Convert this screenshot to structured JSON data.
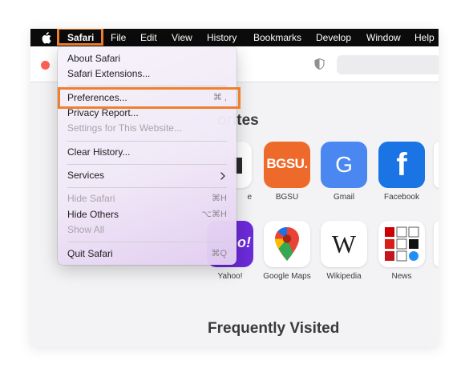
{
  "menubar": {
    "items": [
      {
        "label": "Safari",
        "key": "safari"
      },
      {
        "label": "File",
        "key": "file"
      },
      {
        "label": "Edit",
        "key": "edit"
      },
      {
        "label": "View",
        "key": "view"
      },
      {
        "label": "History",
        "key": "history"
      },
      {
        "label": "Bookmarks",
        "key": "bookmarks"
      },
      {
        "label": "Develop",
        "key": "develop"
      },
      {
        "label": "Window",
        "key": "window"
      },
      {
        "label": "Help",
        "key": "help"
      }
    ]
  },
  "safari_menu": {
    "items": [
      {
        "label": "About Safari",
        "shortcut": "",
        "enabled": true
      },
      {
        "label": "Safari Extensions...",
        "shortcut": "",
        "enabled": true
      },
      {
        "label": "Preferences...",
        "shortcut": "⌘ ,",
        "enabled": true,
        "highlighted": true
      },
      {
        "label": "Privacy Report...",
        "shortcut": "",
        "enabled": true
      },
      {
        "label": "Settings for This Website...",
        "shortcut": "",
        "enabled": false
      },
      {
        "label": "Clear History...",
        "shortcut": "",
        "enabled": true
      },
      {
        "label": "Services",
        "shortcut": "",
        "enabled": true,
        "submenu": true
      },
      {
        "label": "Hide Safari",
        "shortcut": "⌘H",
        "enabled": false
      },
      {
        "label": "Hide Others",
        "shortcut": "⌥⌘H",
        "enabled": true
      },
      {
        "label": "Show All",
        "shortcut": "",
        "enabled": false
      },
      {
        "label": "Quit Safari",
        "shortcut": "⌘Q",
        "enabled": true
      }
    ]
  },
  "start_page": {
    "favorites_title_visible": "orites",
    "frequently_visited_title": "Frequently Visited",
    "favorites": [
      {
        "label": "e",
        "icon": "partial-dark-icon"
      },
      {
        "label": "BGSU",
        "icon": "bgsu-icon",
        "tile_text": "BGSU."
      },
      {
        "label": "Gmail",
        "icon": "google-g-icon",
        "tile_text": "G"
      },
      {
        "label": "Facebook",
        "icon": "facebook-icon",
        "tile_text": "f"
      },
      {
        "label": "Yahoo!",
        "icon": "yahoo-icon",
        "tile_text": "o!"
      },
      {
        "label": "Google Maps",
        "icon": "google-maps-pin-icon"
      },
      {
        "label": "Wikipedia",
        "icon": "wikipedia-icon",
        "tile_text": "W"
      },
      {
        "label": "News",
        "icon": "news-collage-icon"
      }
    ]
  },
  "colors": {
    "highlight_outline": "#f07f2d",
    "close_button": "#ff5f57",
    "bgsu_orange": "#ee6a2a",
    "gmail_blue": "#4a87f0",
    "facebook_blue": "#1b74e4",
    "yahoo_purple": "#6c2bd9"
  }
}
